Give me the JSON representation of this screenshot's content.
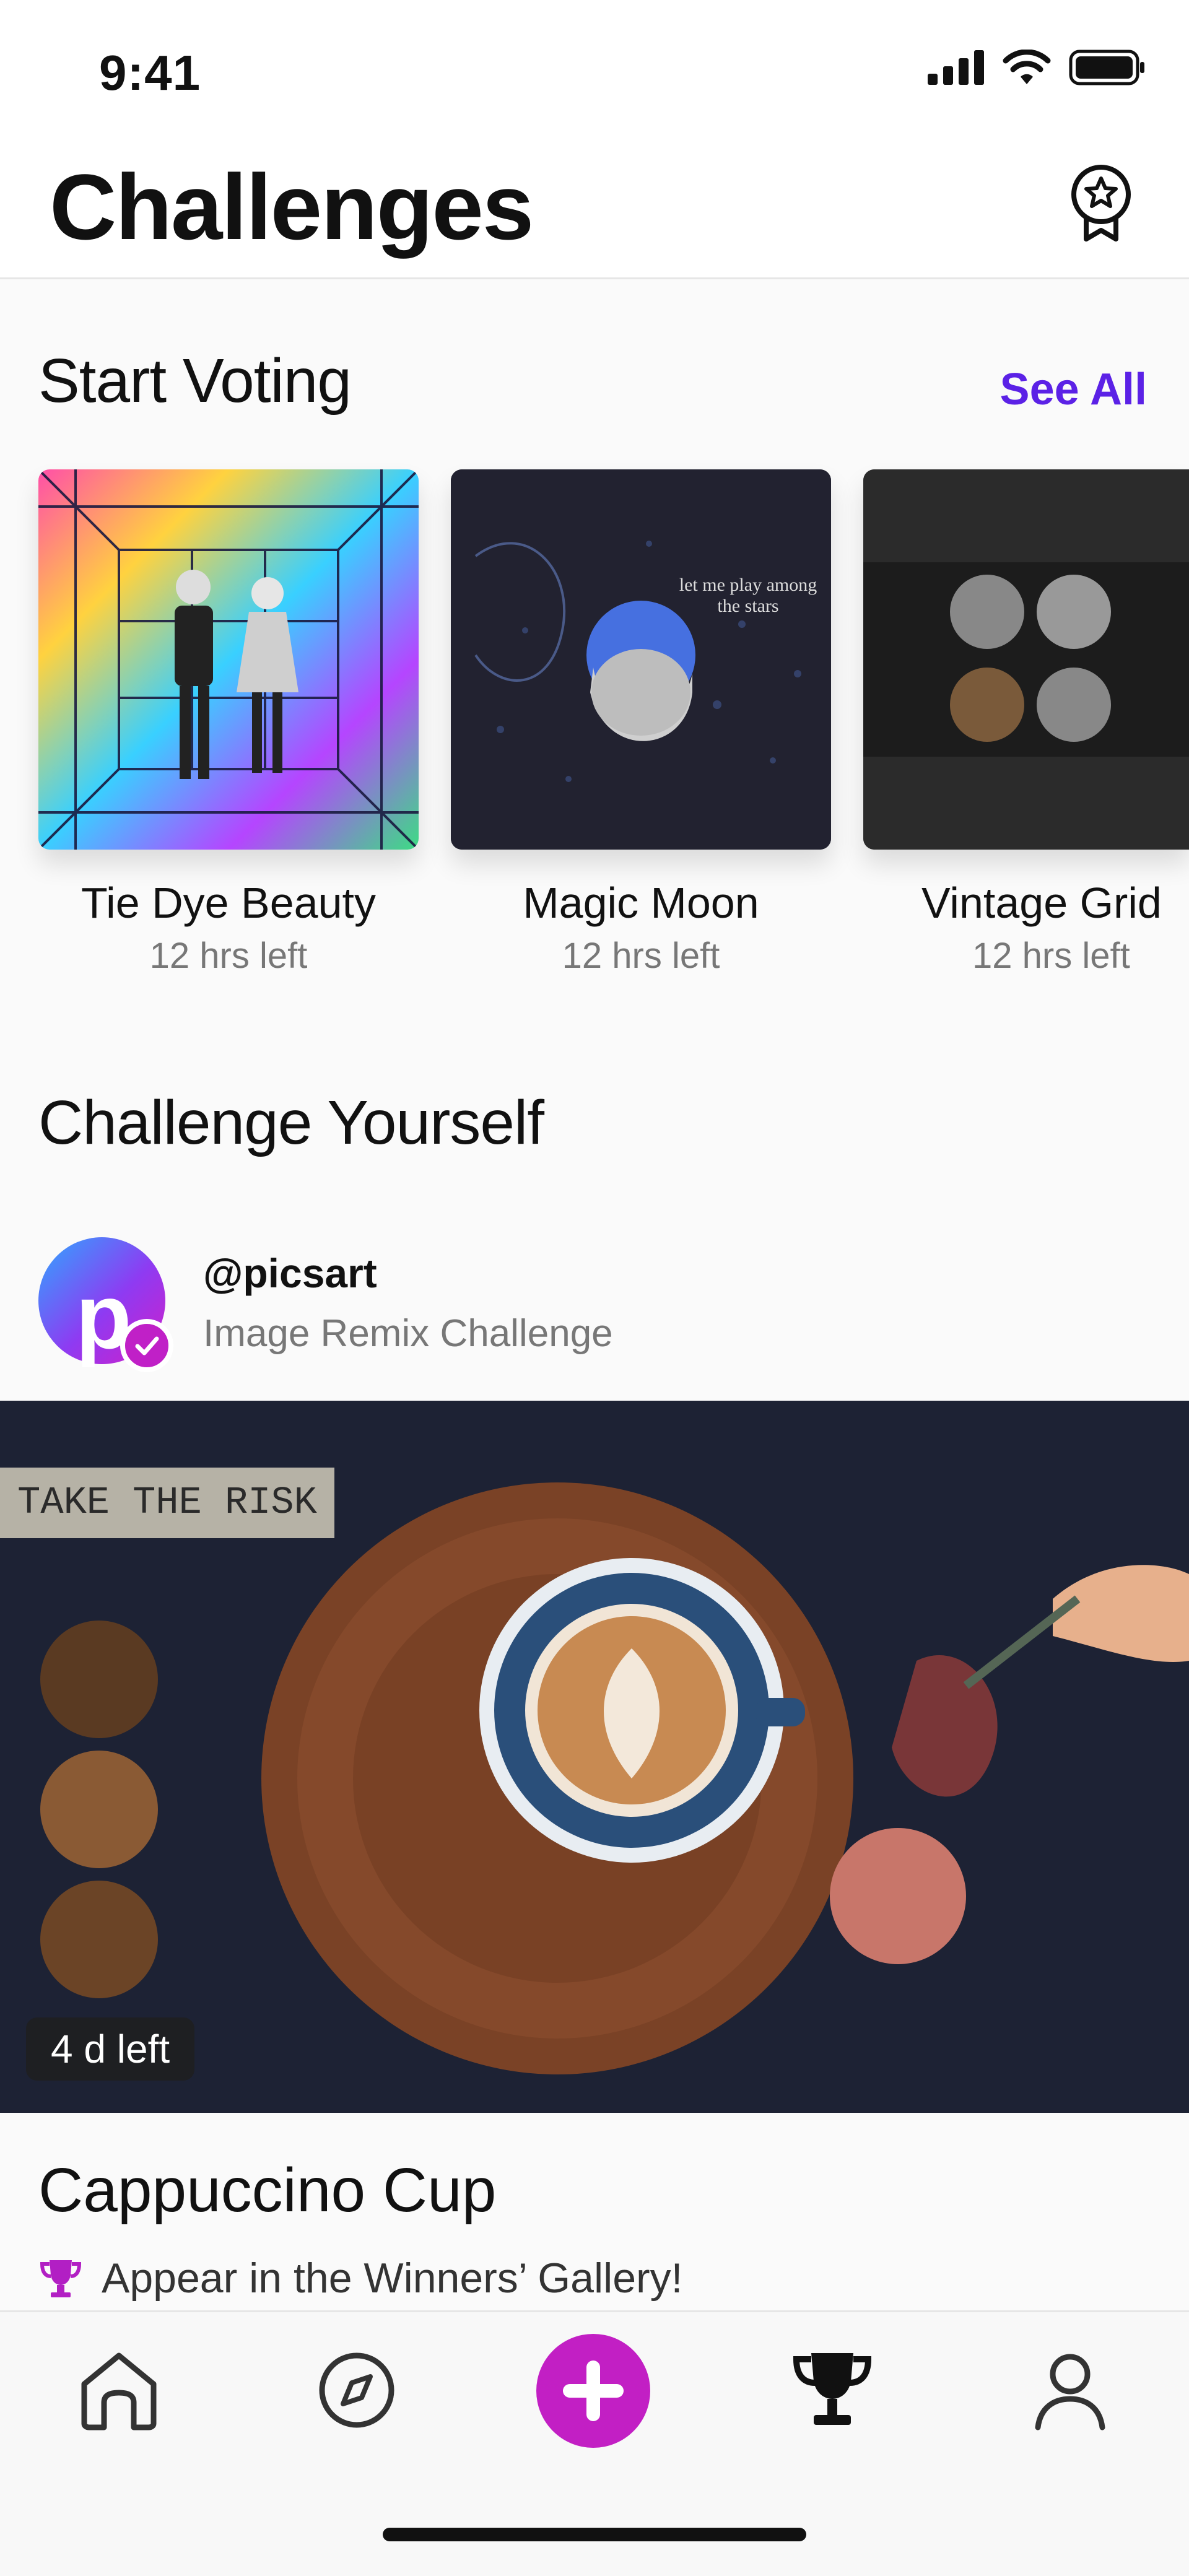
{
  "status_bar": {
    "time": "9:41"
  },
  "header": {
    "title": "Challenges"
  },
  "voting": {
    "heading": "Start Voting",
    "see_all": "See All",
    "cards": [
      {
        "name": "Tie Dye Beauty",
        "time_left": "12 hrs left"
      },
      {
        "name": "Magic Moon",
        "time_left": "12 hrs left",
        "image_text": "let me play among the stars"
      },
      {
        "name": "Vintage Grid",
        "time_left": "12 hrs left"
      }
    ]
  },
  "challenge_yourself": {
    "heading": "Challenge Yourself",
    "author": {
      "handle": "@picsart",
      "subtitle": "Image Remix Challenge",
      "avatar_letter": "p"
    },
    "hero": {
      "banner_text": "TAKE THE RISK",
      "time_left": "4 d left"
    },
    "challenge_title": "Cappuccino Cup",
    "reward": "Appear in the Winners’ Gallery!"
  },
  "tab_bar": {
    "items": [
      {
        "icon": "home-icon"
      },
      {
        "icon": "compass-icon"
      },
      {
        "icon": "plus-icon"
      },
      {
        "icon": "trophy-icon"
      },
      {
        "icon": "profile-icon"
      }
    ]
  },
  "colors": {
    "accent": "#5b21e6",
    "brand": "#c21fc4"
  }
}
